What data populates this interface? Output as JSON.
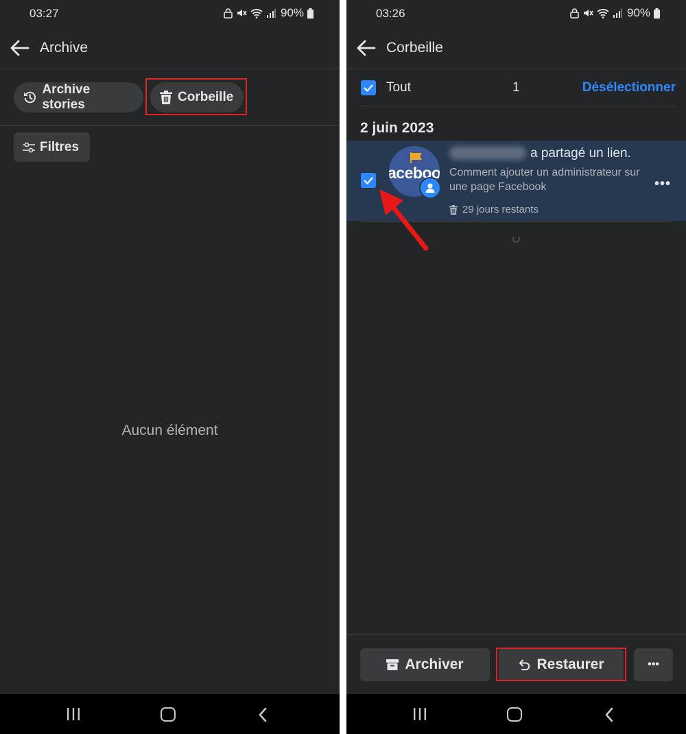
{
  "colors": {
    "background": "#242526",
    "surface": "#3a3b3c",
    "accent": "#2d88ff",
    "highlight_border": "#e02424",
    "selected_row": "#263951"
  },
  "left_screen": {
    "status": {
      "time": "03:27",
      "battery": "90%"
    },
    "header": {
      "title": "Archive",
      "back_icon": "arrow-left-icon"
    },
    "chips": [
      {
        "label": "Archive stories",
        "icon": "clock-history-icon"
      },
      {
        "label": "Corbeille",
        "icon": "trash-icon"
      }
    ],
    "filters_label": "Filtres",
    "empty_text": "Aucun élément"
  },
  "right_screen": {
    "status": {
      "time": "03:26",
      "battery": "90%"
    },
    "header": {
      "title": "Corbeille",
      "back_icon": "arrow-left-icon"
    },
    "select_all": {
      "label": "Tout",
      "count": "1",
      "deselect_label": "Désélectionner"
    },
    "date_heading": "2 juin 2023",
    "item": {
      "action_text": "a partagé un lien.",
      "description": "Comment ajouter un administrateur sur une page Facebook",
      "days_remaining": "29 jours restants",
      "avatar_text": "aceboo",
      "more_icon": "more-horizontal-icon"
    },
    "actions": {
      "archive_label": "Archiver",
      "restore_label": "Restaurer",
      "more_icon": "more-horizontal-icon"
    }
  }
}
